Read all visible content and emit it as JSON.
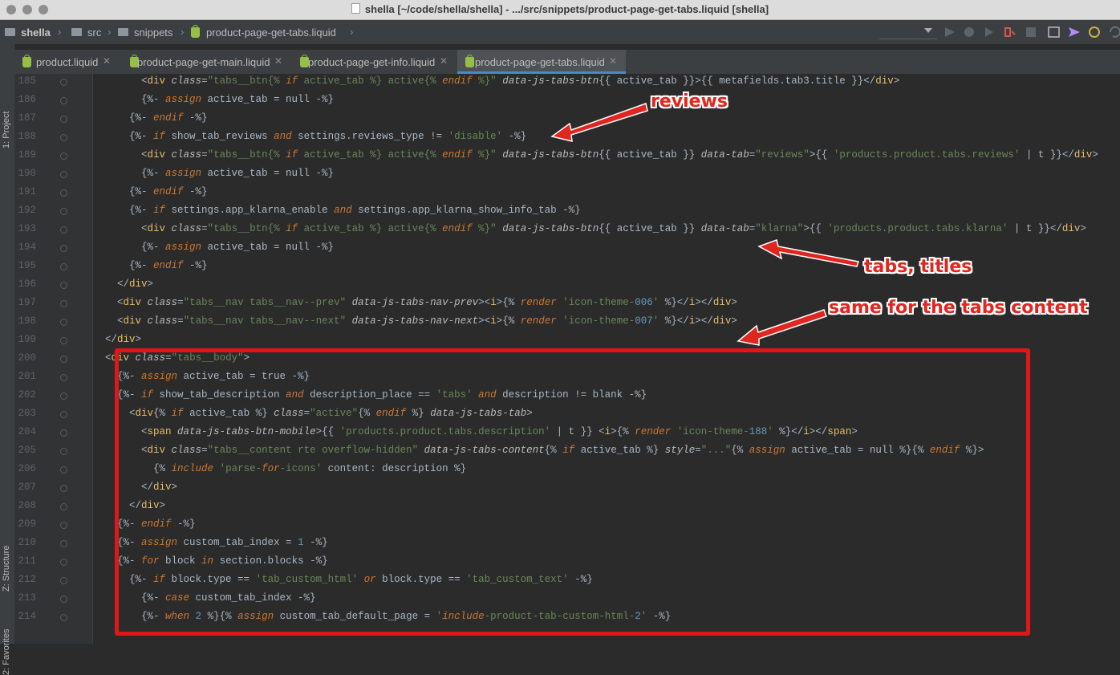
{
  "window": {
    "title": "shella [~/code/shella/shella] - .../src/snippets/product-page-get-tabs.liquid [shella]"
  },
  "breadcrumb": {
    "project": "shella",
    "folder1": "src",
    "folder2": "snippets",
    "file": "product-page-get-tabs.liquid"
  },
  "tabs": [
    {
      "label": "product.liquid",
      "active": false
    },
    {
      "label": "product-page-get-main.liquid",
      "active": false
    },
    {
      "label": "product-page-get-info.liquid",
      "active": false
    },
    {
      "label": "product-page-get-tabs.liquid",
      "active": true
    }
  ],
  "tool_windows": {
    "project": "1: Project",
    "structure": "Z: Structure",
    "favorites": "2: Favorites"
  },
  "annotations": {
    "reviews": "reviews",
    "tabs_titles": "tabs, titles",
    "tabs_content": "same for the tabs content"
  },
  "editor": {
    "lines": [
      {
        "n": "185",
        "text": "        <div class=\"tabs__btn{% if active_tab %} active{% endif %}\" data-js-tabs-btn{{ active_tab }}>{{ metafields.tab3.title }}</div>"
      },
      {
        "n": "186",
        "text": "        {%- assign active_tab = null -%}"
      },
      {
        "n": "187",
        "text": "      {%- endif -%}"
      },
      {
        "n": "188",
        "text": "      {%- if show_tab_reviews and settings.reviews_type != 'disable' -%}"
      },
      {
        "n": "189",
        "text": "        <div class=\"tabs__btn{% if active_tab %} active{% endif %}\" data-js-tabs-btn{{ active_tab }} data-tab=\"reviews\">{{ 'products.product.tabs.reviews' | t }}</div>"
      },
      {
        "n": "190",
        "text": "        {%- assign active_tab = null -%}"
      },
      {
        "n": "191",
        "text": "      {%- endif -%}"
      },
      {
        "n": "192",
        "text": "      {%- if settings.app_klarna_enable and settings.app_klarna_show_info_tab -%}"
      },
      {
        "n": "193",
        "text": "        <div class=\"tabs__btn{% if active_tab %} active{% endif %}\" data-js-tabs-btn{{ active_tab }} data-tab=\"klarna\">{{ 'products.product.tabs.klarna' | t }}</div>"
      },
      {
        "n": "194",
        "text": "        {%- assign active_tab = null -%}"
      },
      {
        "n": "195",
        "text": "      {%- endif -%}"
      },
      {
        "n": "196",
        "text": "    </div>"
      },
      {
        "n": "197",
        "text": "    <div class=\"tabs__nav tabs__nav--prev\" data-js-tabs-nav-prev><i>{% render 'icon-theme-006' %}</i></div>"
      },
      {
        "n": "198",
        "text": "    <div class=\"tabs__nav tabs__nav--next\" data-js-tabs-nav-next><i>{% render 'icon-theme-007' %}</i></div>"
      },
      {
        "n": "199",
        "text": "  </div>"
      },
      {
        "n": "200",
        "text": "  <div class=\"tabs__body\">"
      },
      {
        "n": "201",
        "text": "    {%- assign active_tab = true -%}"
      },
      {
        "n": "202",
        "text": "    {%- if show_tab_description and description_place == 'tabs' and description != blank -%}"
      },
      {
        "n": "203",
        "text": "      <div{% if active_tab %} class=\"active\"{% endif %} data-js-tabs-tab>"
      },
      {
        "n": "204",
        "text": "        <span data-js-tabs-btn-mobile>{{ 'products.product.tabs.description' | t }} <i>{% render 'icon-theme-188' %}</i></span>"
      },
      {
        "n": "205",
        "text": "        <div class=\"tabs__content rte overflow-hidden\" data-js-tabs-content{% if active_tab %} style=\"...\"{% assign active_tab = null %}{% endif %}>"
      },
      {
        "n": "206",
        "text": "          {% include 'parse-for-icons' content: description %}"
      },
      {
        "n": "207",
        "text": "        </div>"
      },
      {
        "n": "208",
        "text": "      </div>"
      },
      {
        "n": "209",
        "text": "    {%- endif -%}"
      },
      {
        "n": "210",
        "text": "    {%- assign custom_tab_index = 1 -%}"
      },
      {
        "n": "211",
        "text": "    {%- for block in section.blocks -%}"
      },
      {
        "n": "212",
        "text": "      {%- if block.type == 'tab_custom_html' or block.type == 'tab_custom_text' -%}"
      },
      {
        "n": "213",
        "text": "        {%- case custom_tab_index -%}"
      },
      {
        "n": "214",
        "text": "        {%- when 2 %}{% assign custom_tab_default_page = 'include-product-tab-custom-html-2' -%}"
      }
    ]
  },
  "colors": {
    "annotation_red": "#e0261f",
    "editor_bg": "#2b2b2b",
    "tab_accent": "#4a88c7",
    "shopify_green": "#95bf47"
  }
}
